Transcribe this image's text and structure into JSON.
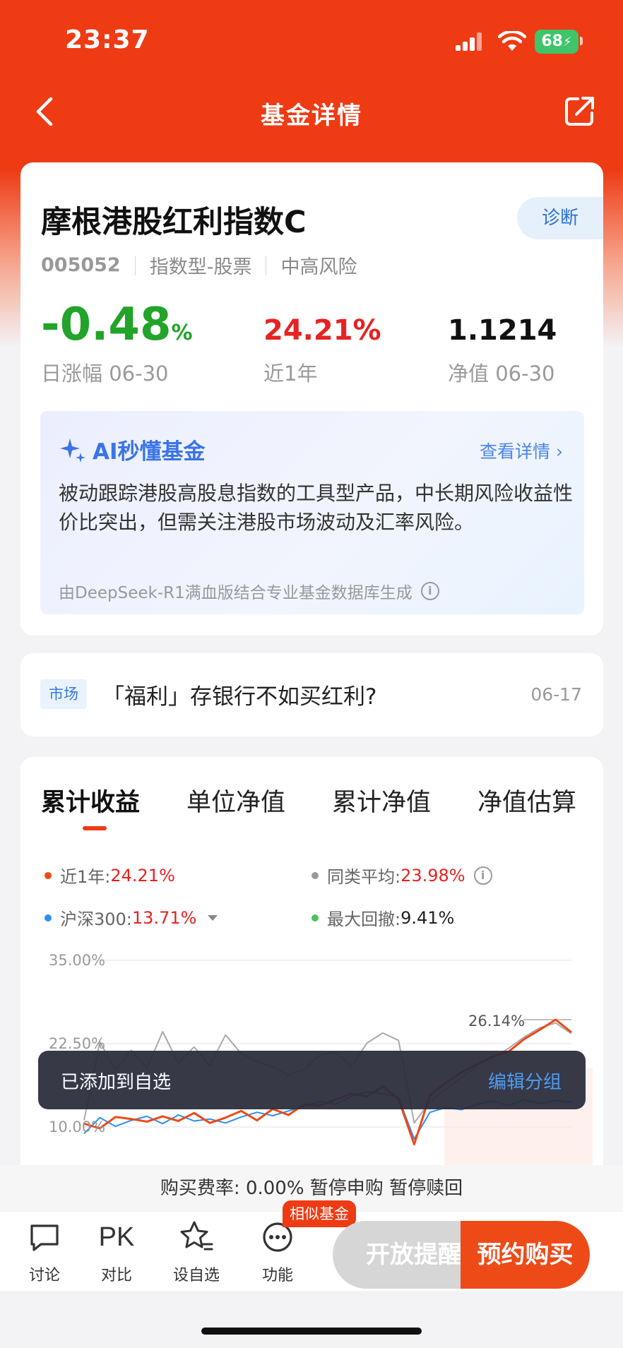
{
  "status_bar": {
    "time": "23:37",
    "battery": "68"
  },
  "nav": {
    "title": "基金详情"
  },
  "fund": {
    "name": "摩根港股红利指数C",
    "diagnose_label": "诊断",
    "code": "005052",
    "type": "指数型-股票",
    "risk": "中高风险",
    "daily_change_value": "-0.48",
    "daily_change_unit": "%",
    "daily_change_label": "日涨幅 06-30",
    "one_year_value": "24.21%",
    "one_year_label": "近1年",
    "nav_value": "1.1214",
    "nav_label": "净值 06-30"
  },
  "ai": {
    "title": "AI秒懂基金",
    "more": "查看详情",
    "text": "被动跟踪港股高股息指数的工具型产品，中长期风险收益性价比突出，但需关注港股市场波动及汇率风险。",
    "source": "由DeepSeek-R1满血版结合专业基金数据库生成"
  },
  "news": {
    "tag": "市场",
    "title": "「福利」存银行不如买红利?",
    "date": "06-17"
  },
  "chart": {
    "tabs": [
      "累计收益",
      "单位净值",
      "累计净值",
      "净值估算"
    ],
    "active_tab": 0,
    "legend": [
      {
        "label": "近1年:",
        "value": "24.21%",
        "color": "#ee4a18"
      },
      {
        "label": "同类平均:",
        "value": "23.98%",
        "color": "#999999"
      },
      {
        "label": "沪深300:",
        "value": "13.71%",
        "color": "#2f8ef0"
      },
      {
        "label": "最大回撤:",
        "value": "9.41%",
        "color": "#4cc35a"
      }
    ],
    "y_ticks": [
      "35.00%",
      "22.50%",
      "10.00%"
    ],
    "peak_label": "26.14%"
  },
  "chart_data": {
    "type": "line",
    "ylim": [
      10,
      35
    ],
    "series": [
      {
        "name": "近1年",
        "values": [
          10.5,
          9.8,
          11.5,
          11.2,
          10.8,
          11.6,
          10.9,
          12.1,
          10.6,
          11.4,
          12.4,
          11.0,
          12.7,
          11.8,
          13.4,
          13.2,
          14.1,
          15.0,
          14.6,
          16.1,
          14.2,
          7.4,
          14.8,
          16.6,
          18.2,
          19.4,
          20.6,
          21.3,
          23.2,
          24.6,
          26.1,
          24.2
        ]
      },
      {
        "name": "同类平均",
        "values": [
          11.0,
          22.8,
          18.5,
          21.5,
          18.8,
          24.3,
          19.6,
          22.0,
          19.2,
          23.8,
          21.0,
          19.8,
          19.0,
          17.8,
          18.6,
          20.8,
          21.2,
          19.1,
          22.6,
          24.1,
          23.0,
          10.6,
          13.8,
          15.6,
          17.4,
          19.2,
          20.4,
          21.8,
          23.5,
          24.9,
          25.6,
          24.0
        ]
      },
      {
        "name": "沪深300",
        "values": [
          9.0,
          11.4,
          10.1,
          11.0,
          11.6,
          10.5,
          11.8,
          10.9,
          11.2,
          10.6,
          11.5,
          12.2,
          11.7,
          12.4,
          13.1,
          13.8,
          13.4,
          14.6,
          15.3,
          15.0,
          14.4,
          8.2,
          12.2,
          12.9,
          12.6,
          13.4,
          13.9,
          13.2,
          14.1,
          13.5,
          14.0,
          13.7
        ]
      }
    ]
  },
  "toast": {
    "text": "已添加到自选",
    "action": "编辑分组"
  },
  "fee_bar": {
    "text": "购买费率: 0.00% 暂停申购 暂停赎回"
  },
  "bottom_bar": {
    "discuss": "讨论",
    "pk_icon_text": "PK",
    "compare": "对比",
    "watchlist": "设自选",
    "functions": "功能",
    "similar_badge": "相似基金",
    "alert_button": "开放提醒",
    "buy_button": "预约购买"
  }
}
